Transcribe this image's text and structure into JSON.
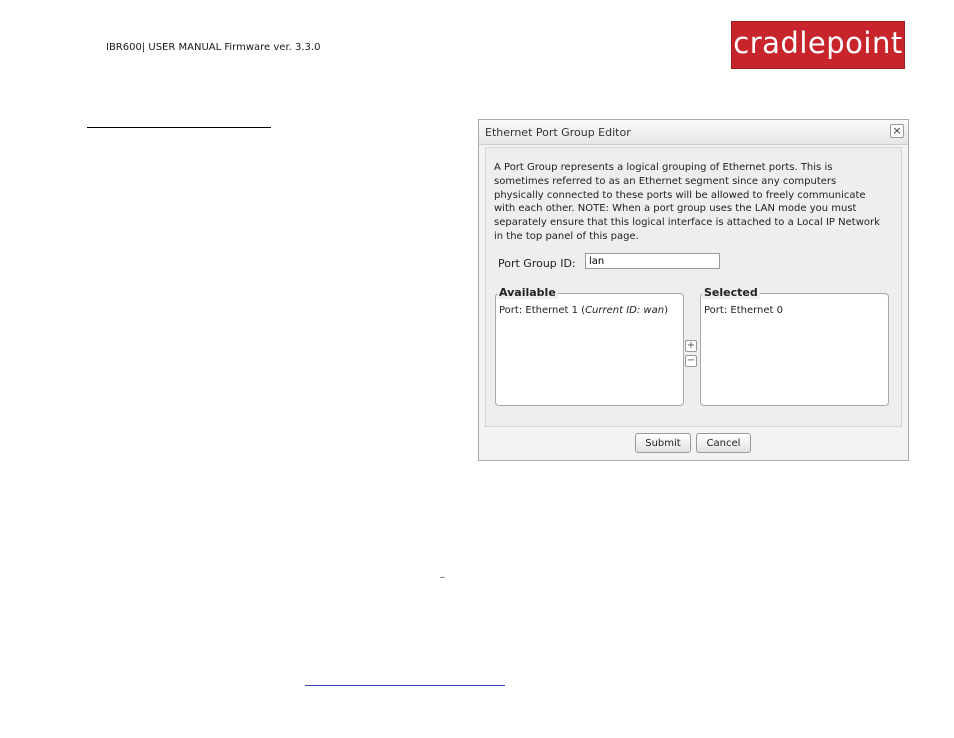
{
  "header": {
    "manual_text": "IBR600| USER MANUAL Firmware ver. 3.3.0",
    "logo_text": "cradlepoint",
    "brand_color": "#c8242b"
  },
  "page": {
    "dash_text": "–"
  },
  "dialog": {
    "title": "Ethernet Port Group Editor",
    "close_glyph": "×",
    "description_lines": [
      "A Port Group represents a logical grouping of Ethernet ports. This is",
      "sometimes referred to as an Ethernet segment since any computers",
      "physically connected to these ports will be allowed to freely communicate",
      "with each other. NOTE: When a port group uses the LAN mode you must",
      "separately ensure that this logical interface is attached to a Local IP Network",
      "in the top panel of this page."
    ],
    "port_group_id_label": "Port Group ID:",
    "port_group_id_value": "lan",
    "available": {
      "legend": "Available",
      "items": [
        {
          "prefix": "Port: Ethernet 1 (",
          "italic": "Current ID: wan",
          "suffix": ")"
        }
      ]
    },
    "selected": {
      "legend": "Selected",
      "items": [
        {
          "text": "Port: Ethernet 0"
        }
      ]
    },
    "add_glyph": "+",
    "remove_glyph": "−",
    "submit_label": "Submit",
    "cancel_label": "Cancel"
  }
}
